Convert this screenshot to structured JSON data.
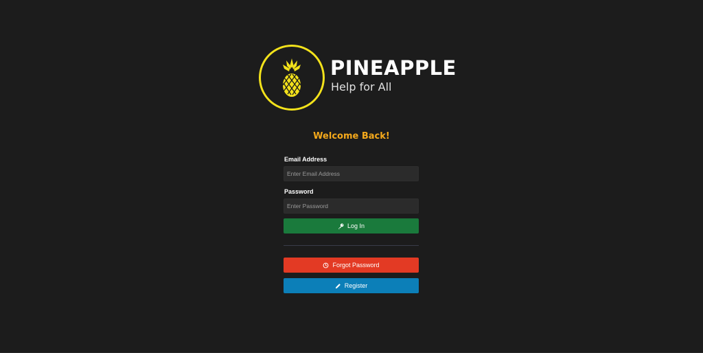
{
  "brand": {
    "name": "PINEAPPLE",
    "tagline": "Help for All",
    "logo_icon": "pineapple-icon",
    "accent_color": "#f3e21b"
  },
  "form": {
    "heading": "Welcome Back!",
    "heading_color": "#f5a91b",
    "email": {
      "label": "Email Address",
      "placeholder": "Enter Email Address",
      "value": ""
    },
    "password": {
      "label": "Password",
      "placeholder": "Enter Password",
      "value": ""
    },
    "login_button": {
      "label": "Log In",
      "icon": "key-icon",
      "color": "#1a7a3c"
    },
    "forgot_button": {
      "label": "Forgot Password",
      "icon": "clock-icon",
      "color": "#e33a24"
    },
    "register_button": {
      "label": "Register",
      "icon": "pencil-icon",
      "color": "#0c7fb8"
    }
  },
  "background_color": "#1c1c1c"
}
